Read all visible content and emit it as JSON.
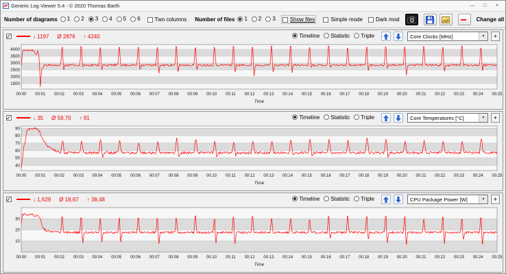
{
  "window": {
    "title": "Generic Log Viewer 5.4 - © 2020 Thomas Barth",
    "minimize_icon": "—",
    "maximize_icon": "□",
    "close_icon": "×"
  },
  "toolbar": {
    "diagrams_label": "Number of diagrams",
    "diagram_options": [
      "1",
      "2",
      "3",
      "4",
      "5",
      "6"
    ],
    "diagrams_selected": "3",
    "two_columns_label": "Two columns",
    "files_label": "Number of files",
    "file_options": [
      "1",
      "2",
      "3"
    ],
    "files_selected": "1",
    "show_files_label": "Show files",
    "simple_mode_label": "Simple mode",
    "dark_mode_label": "Dark mod",
    "change_all_label": "Change all"
  },
  "panel_ui": {
    "plus_label": "+",
    "view_options": [
      "Timeline",
      "Statistic",
      "Triple"
    ],
    "view_selected": "Timeline"
  },
  "panels": [
    {
      "checked": true,
      "stats": {
        "min": "↓ 1197",
        "avg": "Ø 2876",
        "max": "↑ 4240"
      },
      "metric": "Core Clocks [MHz]"
    },
    {
      "checked": true,
      "stats": {
        "min": "↓ 35",
        "avg": "Ø 59,70",
        "max": "↑ 91"
      },
      "metric": "Core Temperatures [°C]"
    },
    {
      "checked": true,
      "stats": {
        "min": "↓ 1,629",
        "avg": "Ø 18,67",
        "max": "↑ 38,48"
      },
      "metric": "CPU Package Power [W]"
    }
  ],
  "chart_data": [
    {
      "type": "line",
      "title": "Core Clocks [MHz]",
      "xlabel": "Time",
      "ylabel": "",
      "ylim": [
        1100,
        4350
      ],
      "yticks": [
        1500,
        2000,
        2500,
        3000,
        3500,
        4000
      ],
      "x_tick_labels": [
        "00:00",
        "00:01",
        "00:02",
        "00:03",
        "00:04",
        "00:05",
        "00:06",
        "00:07",
        "00:08",
        "00:09",
        "00:10",
        "00:11",
        "00:12",
        "00:13",
        "00:14",
        "00:15",
        "00:16",
        "00:17",
        "00:18",
        "00:19",
        "00:20",
        "00:21",
        "00:22",
        "00:23",
        "00:24",
        "00:25"
      ],
      "series": [
        {
          "name": "Core Clocks",
          "color": "#ff0000",
          "stats": {
            "min": 1197,
            "avg": 2876,
            "max": 4240
          },
          "waveform": {
            "duration_s": 1500,
            "step_s": 2,
            "baseline": 2850,
            "noise": 70,
            "warmup": [
              [
                0,
                2750
              ],
              [
                4,
                3900
              ],
              [
                12,
                3950
              ],
              [
                22,
                3890
              ],
              [
                32,
                3960
              ],
              [
                42,
                3870
              ],
              [
                47,
                3520
              ],
              [
                52,
                3950
              ],
              [
                57,
                3300
              ],
              [
                60,
                1197
              ],
              [
                64,
                2500
              ],
              [
                72,
                2830
              ],
              [
                120,
                2850
              ]
            ],
            "spike_start_s": 125,
            "period_s": 60,
            "peak": 4160,
            "peak_jitter": 90,
            "dip": 2350,
            "dip_jitter": 500,
            "dip_chance": 0.75,
            "rise_s": 3,
            "top_s": 2,
            "fall_s": 3,
            "dip_len_s": 5,
            "clamp": [
              1197,
              4240
            ]
          }
        }
      ]
    },
    {
      "type": "line",
      "title": "Core Temperatures [°C]",
      "xlabel": "Time",
      "ylabel": "",
      "ylim": [
        33,
        93
      ],
      "yticks": [
        40,
        50,
        60,
        70,
        80,
        90
      ],
      "x_tick_labels": [
        "00:00",
        "00:01",
        "00:02",
        "00:03",
        "00:04",
        "00:05",
        "00:06",
        "00:07",
        "00:08",
        "00:09",
        "00:10",
        "00:11",
        "00:12",
        "00:13",
        "00:14",
        "00:15",
        "00:16",
        "00:17",
        "00:18",
        "00:19",
        "00:20",
        "00:21",
        "00:22",
        "00:23",
        "00:24",
        "00:25"
      ],
      "series": [
        {
          "name": "Core Temperatures",
          "color": "#ff0000",
          "stats": {
            "min": 35,
            "avg": 59.7,
            "max": 91
          },
          "waveform": {
            "duration_s": 1500,
            "step_s": 2,
            "baseline": 57,
            "noise": 1.6,
            "warmup": [
              [
                0,
                35
              ],
              [
                8,
                64
              ],
              [
                18,
                86
              ],
              [
                30,
                90
              ],
              [
                48,
                90
              ],
              [
                58,
                85
              ],
              [
                70,
                74
              ],
              [
                85,
                65
              ],
              [
                100,
                61
              ],
              [
                120,
                58
              ]
            ],
            "spike_start_s": 125,
            "period_s": 60,
            "peak": 74,
            "peak_jitter": 4,
            "dip": 52,
            "dip_jitter": 2,
            "dip_chance": 0.5,
            "rise_s": 4,
            "top_s": 2,
            "fall_s": 5,
            "dip_len_s": 6,
            "clamp": [
              35,
              91
            ]
          }
        }
      ]
    },
    {
      "type": "line",
      "title": "CPU Package Power [W]",
      "xlabel": "Time",
      "ylabel": "",
      "ylim": [
        0,
        40
      ],
      "yticks": [
        10,
        20,
        30
      ],
      "x_tick_labels": [
        "00:00",
        "00:01",
        "00:02",
        "00:03",
        "00:04",
        "00:05",
        "00:06",
        "00:07",
        "00:08",
        "00:09",
        "00:10",
        "00:11",
        "00:12",
        "00:13",
        "00:14",
        "00:15",
        "00:16",
        "00:17",
        "00:18",
        "00:19",
        "00:20",
        "00:21",
        "00:22",
        "00:23",
        "00:24",
        "00:25"
      ],
      "series": [
        {
          "name": "CPU Package Power",
          "color": "#ff0000",
          "stats": {
            "min": 1.629,
            "avg": 18.67,
            "max": 38.48
          },
          "waveform": {
            "duration_s": 1500,
            "step_s": 2,
            "baseline": 17.6,
            "noise": 0.9,
            "warmup": [
              [
                0,
                26
              ],
              [
                4,
                33
              ],
              [
                12,
                34.5
              ],
              [
                22,
                33
              ],
              [
                32,
                35
              ],
              [
                42,
                32
              ],
              [
                52,
                33.5
              ],
              [
                60,
                30
              ],
              [
                68,
                22
              ],
              [
                80,
                19
              ],
              [
                120,
                17.8
              ]
            ],
            "spike_start_s": 125,
            "period_s": 60,
            "peak": 30.5,
            "peak_jitter": 1.8,
            "dip": 8,
            "dip_jitter": 4,
            "dip_chance": 0.4,
            "rise_s": 3,
            "top_s": 2,
            "fall_s": 3,
            "dip_len_s": 5,
            "clamp": [
              1.629,
              38.48
            ]
          }
        }
      ]
    }
  ]
}
